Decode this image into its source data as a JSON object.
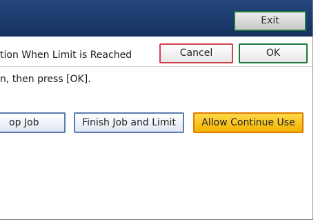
{
  "header": {
    "exit_label": "Exit"
  },
  "dialog": {
    "title": "tion When Limit is Reached",
    "cancel_label": "Cancel",
    "ok_label": "OK",
    "instruction": "n, then press [OK]."
  },
  "options": {
    "stop_job_label": "op Job",
    "finish_job_label": "Finish Job and Limit",
    "allow_continue_label": "Allow Continue Use",
    "selected": "Allow Continue Use"
  },
  "colors": {
    "header_bg": "#1b3a6b",
    "ok_border": "#1c7a3b",
    "cancel_border": "#d2404d",
    "selected_bg": "#f5c400",
    "option_border": "#5a7fae"
  }
}
